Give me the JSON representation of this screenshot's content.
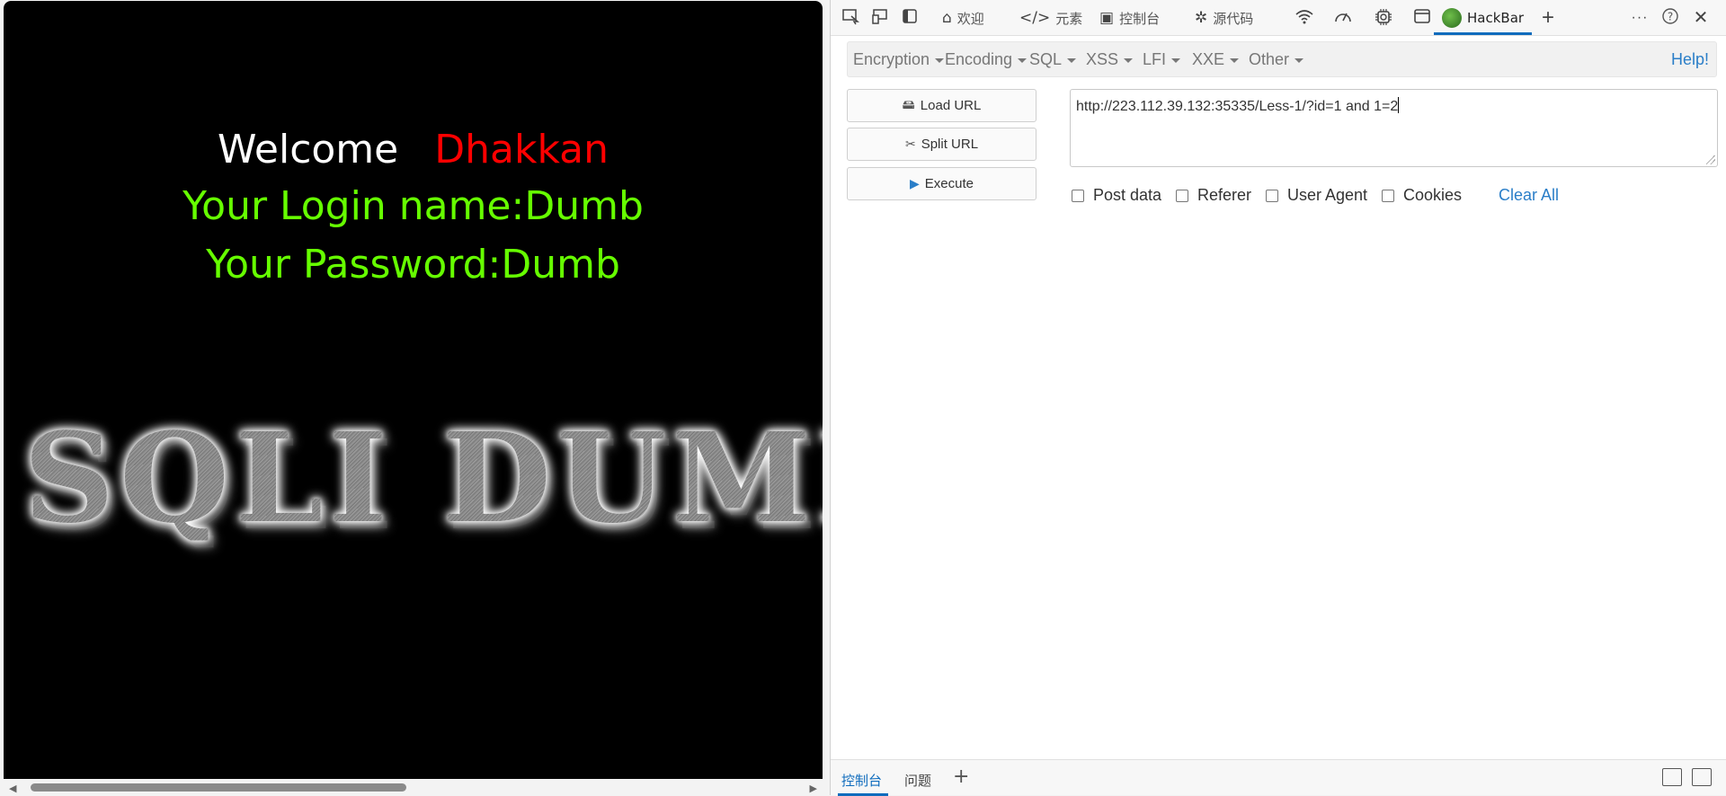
{
  "page": {
    "welcome_word": "Welcome",
    "welcome_name": "Dhakkan",
    "login_line": "Your Login name:Dumb",
    "password_line": "Your Password:Dumb",
    "banner": "SQLI DUMB"
  },
  "devtools": {
    "tabs": {
      "welcome": "欢迎",
      "elements": "元素",
      "console": "控制台",
      "sources": "源代码",
      "hackbar": "HackBar"
    },
    "icons": {
      "inspect": "inspect-icon",
      "device": "device-emulation-icon",
      "dock": "dock-icon",
      "network": "wifi-icon",
      "performance": "gauge-icon",
      "memory": "chip-icon",
      "application": "window-icon",
      "add": "plus-icon",
      "more": "more-icon",
      "help": "help-icon",
      "close": "close-icon"
    },
    "drawer": {
      "console": "控制台",
      "issues": "问题",
      "add": "+"
    }
  },
  "hackbar": {
    "menus": [
      "Encryption",
      "Encoding",
      "SQL",
      "XSS",
      "LFI",
      "XXE",
      "Other"
    ],
    "help": "Help!",
    "buttons": {
      "load": "Load URL",
      "split": "Split URL",
      "execute": "Execute"
    },
    "url": "http://223.112.39.132:35335/Less-1/?id=1 and 1=2",
    "options": {
      "post_data": "Post data",
      "referer": "Referer",
      "user_agent": "User Agent",
      "cookies": "Cookies"
    },
    "clear_all": "Clear All",
    "accent_color": "#2a7ec8"
  }
}
